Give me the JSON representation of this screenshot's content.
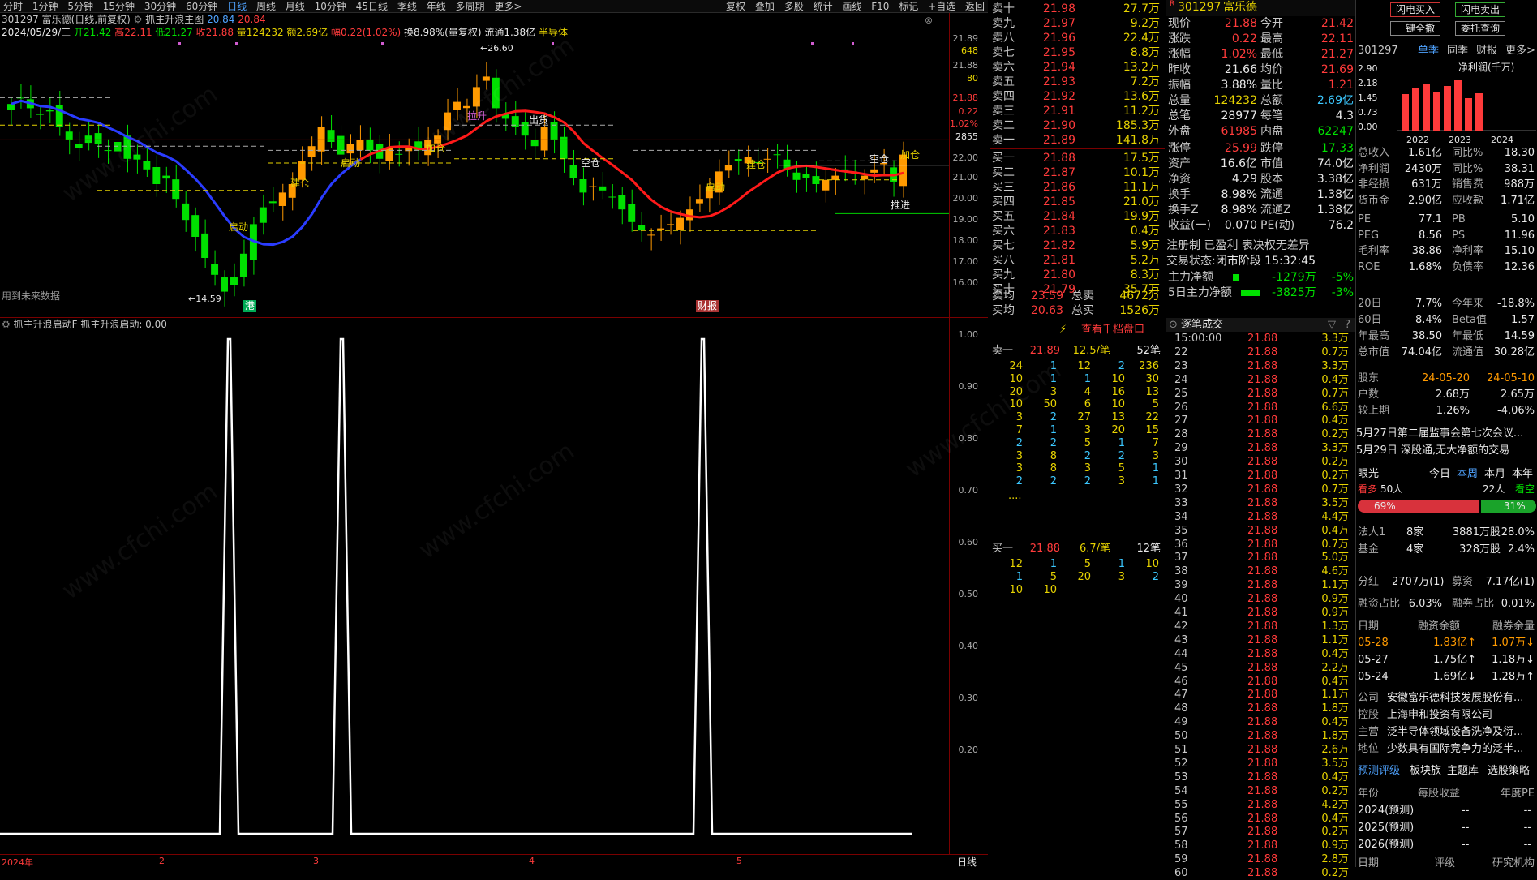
{
  "toolbar": {
    "periods": [
      "分时",
      "1分钟",
      "5分钟",
      "15分钟",
      "30分钟",
      "60分钟",
      "日线",
      "周线",
      "月线",
      "10分钟",
      "45日线",
      "季线",
      "年线",
      "多周期",
      "更多>"
    ],
    "active": "日线",
    "right_buttons": [
      "复权",
      "叠加",
      "多股",
      "统计",
      "画线",
      "F10",
      "标记",
      "+自选",
      "返回"
    ]
  },
  "main_chart": {
    "title": "301297 富乐德(日线,前复权)",
    "indicator_name": "抓主升浪主图",
    "ind_val_blue": "20.84",
    "ind_val_red": "20.84",
    "info_date": "2024/05/29/三",
    "info_open": "开21.42",
    "info_high": "高22.11",
    "info_low": "低21.27",
    "info_close": "收21.88",
    "info_vol": "量124232",
    "info_amt": "额2.69亿",
    "info_chg": "幅0.22(1.02%)",
    "info_turn": "换8.98%(量复权)",
    "info_float": "流通1.38亿",
    "info_sector": "半导体",
    "y_labels": [
      "21.89",
      "648",
      "21.88",
      "80",
      "21.88",
      "0.22",
      "1.02%",
      "2855",
      "22.00",
      "21.00",
      "20.00",
      "19.00",
      "18.00",
      "17.00",
      "16.00"
    ],
    "peak_label": "26.60",
    "low_label": "14.59",
    "annotations": [
      "启动",
      "建仓",
      "启动",
      "加仓",
      "拉升",
      "出货",
      "空仓",
      "启动",
      "建仓",
      "空仓",
      "加仓",
      "推进"
    ],
    "bottom_text": "用到未来数据",
    "event_labels": [
      "港",
      "财报"
    ]
  },
  "indicator_panel": {
    "title": "抓主升浪启动F",
    "value_text": "抓主升浪启动: 0.00",
    "y_labels": [
      "1.00",
      "0.90",
      "0.80",
      "0.70",
      "0.60",
      "0.50",
      "0.40",
      "0.30",
      "0.20"
    ]
  },
  "x_axis": {
    "labels": [
      "2024年",
      "2",
      "3",
      "4",
      "5"
    ],
    "period_tag": "日线"
  },
  "order_book": {
    "sell": [
      {
        "k": "卖十",
        "p": "21.98",
        "v": "27.7万"
      },
      {
        "k": "卖九",
        "p": "21.97",
        "v": "9.2万"
      },
      {
        "k": "卖八",
        "p": "21.96",
        "v": "22.4万"
      },
      {
        "k": "卖七",
        "p": "21.95",
        "v": "8.8万"
      },
      {
        "k": "卖六",
        "p": "21.94",
        "v": "13.2万"
      },
      {
        "k": "卖五",
        "p": "21.93",
        "v": "7.2万"
      },
      {
        "k": "卖四",
        "p": "21.92",
        "v": "13.6万"
      },
      {
        "k": "卖三",
        "p": "21.91",
        "v": "11.2万"
      },
      {
        "k": "卖二",
        "p": "21.90",
        "v": "185.3万"
      },
      {
        "k": "卖一",
        "p": "21.89",
        "v": "141.8万"
      }
    ],
    "buy": [
      {
        "k": "买一",
        "p": "21.88",
        "v": "17.5万"
      },
      {
        "k": "买二",
        "p": "21.87",
        "v": "10.1万"
      },
      {
        "k": "买三",
        "p": "21.86",
        "v": "11.1万"
      },
      {
        "k": "买四",
        "p": "21.85",
        "v": "21.0万"
      },
      {
        "k": "买五",
        "p": "21.84",
        "v": "19.9万"
      },
      {
        "k": "买六",
        "p": "21.83",
        "v": "0.4万"
      },
      {
        "k": "买七",
        "p": "21.82",
        "v": "5.9万"
      },
      {
        "k": "买八",
        "p": "21.81",
        "v": "5.2万"
      },
      {
        "k": "买九",
        "p": "21.80",
        "v": "8.3万"
      },
      {
        "k": "买十",
        "p": "21.79",
        "v": "35.7万"
      }
    ],
    "avg_sell_k": "卖均",
    "avg_sell": "23.59",
    "total_sell_k": "总卖",
    "total_sell": "4672万",
    "avg_buy_k": "买均",
    "avg_buy": "20.63",
    "total_buy_k": "总买",
    "total_buy": "1526万"
  },
  "quote": {
    "code": "301297",
    "name": "富乐德",
    "rows": [
      [
        "现价",
        "21.88",
        "今开",
        "21.42"
      ],
      [
        "涨跌",
        "0.22",
        "最高",
        "22.11"
      ],
      [
        "涨幅",
        "1.02%",
        "最低",
        "21.27"
      ],
      [
        "昨收",
        "21.66",
        "均价",
        "21.69"
      ],
      [
        "振幅",
        "3.88%",
        "量比",
        "1.21"
      ],
      [
        "总量",
        "124232",
        "总额",
        "2.69亿"
      ],
      [
        "总笔",
        "28977",
        "每笔",
        "4.3"
      ],
      [
        "外盘",
        "61985",
        "内盘",
        "62247"
      ],
      [
        "涨停",
        "25.99",
        "跌停",
        "17.33"
      ],
      [
        "资产",
        "16.6亿",
        "市值",
        "74.0亿"
      ],
      [
        "净资",
        "4.29",
        "股本",
        "3.38亿"
      ],
      [
        "换手",
        "8.98%",
        "流通",
        "1.38亿"
      ],
      [
        "换手Z",
        "8.98%",
        "流通Z",
        "1.38亿"
      ],
      [
        "收益(一)",
        "0.070",
        "PE(动)",
        "76.2"
      ]
    ],
    "reg": "注册制 已盈利 表决权无差异",
    "status_label": "交易状态:",
    "status": "闭市阶段 15:32:45",
    "mainflow_k": "主力净额",
    "mainflow_v": "-1279万",
    "mainflow_p": "-5%",
    "flow5_k": "5日主力净额",
    "flow5_v": "-3825万",
    "flow5_p": "-3%"
  },
  "level2": {
    "link": "查看千档盘口",
    "sell1_k": "卖一",
    "sell1_p": "21.89",
    "sell1_avg": "12.5/笔",
    "sell1_cnt": "52笔",
    "sell_queue": [
      [
        "24",
        "1",
        "12",
        "2",
        "236"
      ],
      [
        "10",
        "1",
        "1",
        "10",
        "30"
      ],
      [
        "20",
        "3",
        "4",
        "16",
        "13"
      ],
      [
        "10",
        "50",
        "6",
        "10",
        "5"
      ],
      [
        "3",
        "2",
        "27",
        "13",
        "22"
      ],
      [
        "7",
        "1",
        "3",
        "20",
        "15"
      ],
      [
        "2",
        "2",
        "5",
        "1",
        "7"
      ],
      [
        "3",
        "8",
        "2",
        "2",
        "3"
      ],
      [
        "3",
        "8",
        "3",
        "5",
        "1"
      ],
      [
        "2",
        "2",
        "2",
        "3",
        "1"
      ]
    ],
    "more": "....",
    "buy1_k": "买一",
    "buy1_p": "21.88",
    "buy1_avg": "6.7/笔",
    "buy1_cnt": "12笔",
    "buy_queue": [
      [
        "12",
        "1",
        "5",
        "1",
        "10"
      ],
      [
        "1",
        "5",
        "20",
        "3",
        "2"
      ],
      [
        "10",
        "10",
        "",
        "",
        ""
      ]
    ]
  },
  "ticks": {
    "title": "逐笔成交",
    "rows": [
      [
        "15:00:00",
        "21.88",
        "3.3万"
      ],
      [
        "22",
        "21.88",
        "0.7万"
      ],
      [
        "23",
        "21.88",
        "3.3万"
      ],
      [
        "24",
        "21.88",
        "0.4万"
      ],
      [
        "25",
        "21.88",
        "0.7万"
      ],
      [
        "26",
        "21.88",
        "6.6万"
      ],
      [
        "27",
        "21.88",
        "0.4万"
      ],
      [
        "28",
        "21.88",
        "0.2万"
      ],
      [
        "29",
        "21.88",
        "3.3万"
      ],
      [
        "30",
        "21.88",
        "0.2万"
      ],
      [
        "31",
        "21.88",
        "0.2万"
      ],
      [
        "32",
        "21.88",
        "0.7万"
      ],
      [
        "33",
        "21.88",
        "3.5万"
      ],
      [
        "34",
        "21.88",
        "4.4万"
      ],
      [
        "35",
        "21.88",
        "0.4万"
      ],
      [
        "36",
        "21.88",
        "0.7万"
      ],
      [
        "37",
        "21.88",
        "5.0万"
      ],
      [
        "38",
        "21.88",
        "4.6万"
      ],
      [
        "39",
        "21.88",
        "1.1万"
      ],
      [
        "40",
        "21.88",
        "0.9万"
      ],
      [
        "41",
        "21.88",
        "0.9万"
      ],
      [
        "42",
        "21.88",
        "1.3万"
      ],
      [
        "43",
        "21.88",
        "1.1万"
      ],
      [
        "44",
        "21.88",
        "0.4万"
      ],
      [
        "45",
        "21.88",
        "2.2万"
      ],
      [
        "46",
        "21.88",
        "0.4万"
      ],
      [
        "47",
        "21.88",
        "1.1万"
      ],
      [
        "48",
        "21.88",
        "1.8万"
      ],
      [
        "49",
        "21.88",
        "0.4万"
      ],
      [
        "50",
        "21.88",
        "1.8万"
      ],
      [
        "51",
        "21.88",
        "2.6万"
      ],
      [
        "52",
        "21.88",
        "3.5万"
      ],
      [
        "53",
        "21.88",
        "0.4万"
      ],
      [
        "54",
        "21.88",
        "0.2万"
      ],
      [
        "55",
        "21.88",
        "4.2万"
      ],
      [
        "56",
        "21.88",
        "0.4万"
      ],
      [
        "57",
        "21.88",
        "0.2万"
      ],
      [
        "58",
        "21.88",
        "0.9万"
      ],
      [
        "59",
        "21.88",
        "2.8万"
      ],
      [
        "60",
        "21.88",
        "0.2万"
      ]
    ]
  },
  "rpanel": {
    "btn_buy": "闪电买入",
    "btn_sell": "闪电卖出",
    "btn_cancel": "一键全撤",
    "btn_query": "委托查询",
    "code": "301297",
    "tabs": [
      "单季",
      "同季",
      "财报",
      "更多>"
    ],
    "chart_title": "净利润(千万)",
    "chart_y": [
      "2.90",
      "2.18",
      "1.45",
      "0.73",
      "0.00"
    ],
    "chart_x": [
      "2022",
      "2023",
      "2024"
    ],
    "fin": [
      [
        "总收入",
        "1.61亿",
        "同比%",
        "18.30"
      ],
      [
        "净利润",
        "2430万",
        "同比%",
        "38.31"
      ],
      [
        "非经损",
        "631万",
        "销售费",
        "988万"
      ],
      [
        "货币金",
        "2.90亿",
        "应收款",
        "1.71亿"
      ],
      [
        "PE",
        "77.1",
        "PB",
        "5.10"
      ],
      [
        "PEG",
        "8.56",
        "PS",
        "11.96"
      ],
      [
        "毛利率",
        "38.86",
        "净利率",
        "15.10"
      ],
      [
        "ROE",
        "1.68%",
        "负债率",
        "12.36"
      ]
    ],
    "perf": [
      [
        "20日",
        "7.7%",
        "今年来",
        "-18.8%"
      ],
      [
        "60日",
        "8.4%",
        "Beta值",
        "1.57"
      ],
      [
        "年最高",
        "38.50",
        "年最低",
        "14.59"
      ],
      [
        "总市值",
        "74.04亿",
        "流通值",
        "30.28亿"
      ]
    ],
    "holders_k": "股东",
    "holders_d1": "24-05-20",
    "holders_d2": "24-05-10",
    "hu_k": "户数",
    "hu_1": "2.68万",
    "hu_2": "2.65万",
    "prev_k": "较上期",
    "prev_1": "1.26%",
    "prev_2": "-4.06%",
    "news": [
      "5月27日第二届监事会第七次会议...",
      "5月29日 深股通,无大净额的交易"
    ],
    "yan_k": "眼光",
    "yan_tabs": [
      "今日",
      "本周",
      "本月",
      "本年"
    ],
    "bull_k": "看多",
    "bull_n": "50人",
    "bear_n": "22人",
    "bear_k": "看空",
    "bull_p": "69%",
    "bear_p": "31%",
    "inst": [
      [
        "法人1",
        "8家",
        "3881万股",
        "28.0%"
      ],
      [
        "基金",
        "4家",
        "328万股",
        "2.4%"
      ]
    ],
    "div": [
      "分红",
      "2707万(1)",
      "募资",
      "7.17亿(1)"
    ],
    "margin": [
      "融资占比",
      "6.03%",
      "融券占比",
      "0.01%"
    ],
    "mhead": [
      "日期",
      "融资余额",
      "融券余量"
    ],
    "mrows": [
      [
        "05-28",
        "1.83亿↑",
        "1.07万↓"
      ],
      [
        "05-27",
        "1.75亿↑",
        "1.18万↓"
      ],
      [
        "05-24",
        "1.69亿↓",
        "1.28万↑"
      ]
    ],
    "company": [
      [
        "公司",
        "安徽富乐德科技发展股份有..."
      ],
      [
        "控股",
        "上海申和投资有限公司"
      ],
      [
        "主营",
        "泛半导体领域设备洗净及衍..."
      ],
      [
        "地位",
        "少数具有国际竞争力的泛半..."
      ]
    ],
    "ftabs": [
      "预测评级",
      "板块族",
      "主题库",
      "选股策略"
    ],
    "fhead": [
      "年份",
      "每股收益",
      "年度PE"
    ],
    "frows": [
      [
        "2024(预测)",
        "--",
        "--"
      ],
      [
        "2025(预测)",
        "--",
        "--"
      ],
      [
        "2026(预测)",
        "--",
        "--"
      ]
    ],
    "bottom": [
      "日期",
      "评级",
      "研究机构"
    ]
  },
  "colors": {
    "up": "#ff3b3b",
    "down": "#00e000",
    "bg": "#000000",
    "grid": "#7a0000",
    "accent": "#4fa3ff"
  }
}
